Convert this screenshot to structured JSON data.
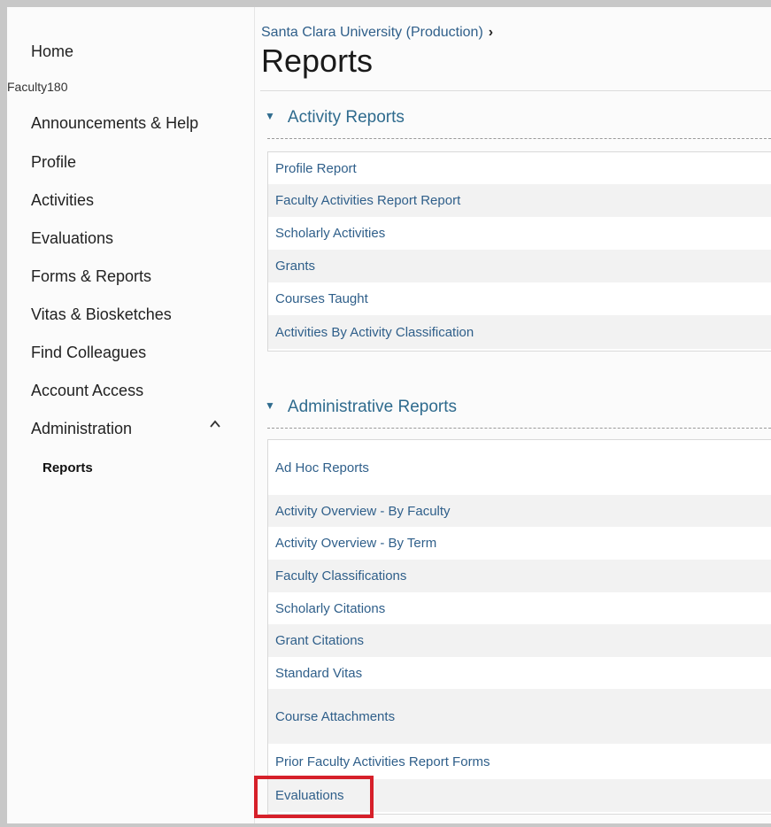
{
  "sidebar": {
    "items": [
      {
        "label": "Home"
      },
      {
        "label": "Announcements & Help"
      },
      {
        "label": "Profile"
      },
      {
        "label": "Activities"
      },
      {
        "label": "Evaluations"
      },
      {
        "label": "Forms & Reports"
      },
      {
        "label": "Vitas & Biosketches"
      },
      {
        "label": "Find Colleagues"
      },
      {
        "label": "Account Access"
      },
      {
        "label": "Administration"
      }
    ],
    "heading": "Faculty180",
    "sub_item": "Reports",
    "chevron_icon": "chevron-up-icon"
  },
  "breadcrumb": {
    "link": "Santa Clara University (Production)",
    "separator": "›"
  },
  "page_title": "Reports",
  "sections": [
    {
      "title": "Activity Reports",
      "rows": [
        "Profile Report",
        "Faculty Activities Report Report",
        "Scholarly Activities",
        "Grants",
        "Courses Taught",
        "Activities By Activity Classification"
      ]
    },
    {
      "title": "Administrative Reports",
      "rows": [
        "Ad Hoc Reports",
        "Activity Overview - By Faculty",
        "Activity Overview - By Term",
        "Faculty Classifications",
        "Scholarly Citations",
        "Grant Citations",
        "Standard Vitas",
        "Course Attachments",
        "Prior Faculty Activities Report Forms",
        "Evaluations"
      ]
    }
  ],
  "colors": {
    "link": "#2f5f8a",
    "section": "#2f6b8e",
    "highlight": "#d6202a"
  }
}
